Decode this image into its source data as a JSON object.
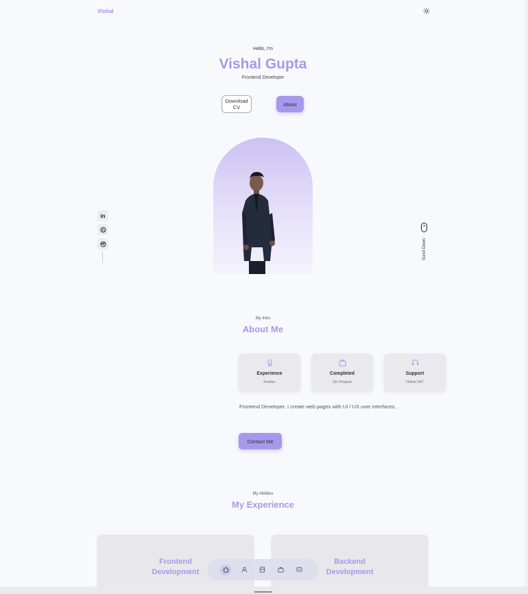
{
  "header": {
    "logo": "Vishal",
    "theme_icon": "sun-icon"
  },
  "hero": {
    "greeting": "Hello, I'm",
    "name": "Vishal Gupta",
    "role": "Frontend Developer",
    "download_cv_label": "Download CV",
    "about_label": "About"
  },
  "social": {
    "items": [
      {
        "icon": "linkedin-icon",
        "label": "in"
      },
      {
        "icon": "github-icon"
      },
      {
        "icon": "dribbble-icon"
      }
    ]
  },
  "scroll": {
    "label": "Scroll Down"
  },
  "about": {
    "subtitle": "My Intro",
    "title": "About Me",
    "cards": [
      {
        "icon": "award-icon",
        "title": "Experience",
        "subtitle": "Fresher"
      },
      {
        "icon": "briefcase-icon",
        "title": "Completed",
        "subtitle": "10+ Projects"
      },
      {
        "icon": "headset-icon",
        "title": "Support",
        "subtitle": "Online 24/7"
      }
    ],
    "description": "Frontend Developer. I create web pages with UI / UX user interfaces,",
    "contact_label": "Contact Me"
  },
  "experience": {
    "subtitle": "My Abilities",
    "title": "My Experience",
    "cards": [
      {
        "title_line1": "Frontend",
        "title_line2": "Development"
      },
      {
        "title_line1": "Backend",
        "title_line2": "Development"
      }
    ]
  },
  "nav": {
    "items": [
      {
        "icon": "home-icon",
        "active": true
      },
      {
        "icon": "user-icon"
      },
      {
        "icon": "document-icon"
      },
      {
        "icon": "briefcase-icon"
      },
      {
        "icon": "message-icon"
      }
    ]
  },
  "colors": {
    "accent": "#a799e8",
    "button": "#a698ea",
    "background": "#f8f9fd"
  }
}
